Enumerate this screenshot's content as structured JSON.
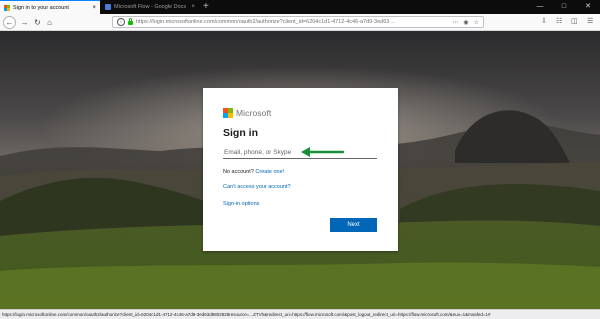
{
  "tabs": [
    {
      "label": "Sign in to your account",
      "close": "×"
    },
    {
      "label": "Microsoft Flow - Google Docs",
      "close": "×"
    }
  ],
  "toolbar": {
    "new_tab": "+",
    "url": "https://login.microsoftonline.com/common/oauth2/authorize?client_id=6204c1d1-4712-4c46-a7d9-3ed63",
    "url_host": "login.microsoftonline.com",
    "url_ellipsis": "..."
  },
  "card": {
    "brand": "Microsoft",
    "title": "Sign in",
    "email_placeholder": "Email, phone, or Skype",
    "no_account_text": "No account?",
    "create_link": "Create one!",
    "cant_access_link": "Can’t access your account?",
    "signin_options_link": "Sign-in options",
    "next_button": "Next"
  },
  "status": {
    "text": "https://login.microsoftonline.com/common/oauth2/authorize?client_id=6204c1d1-4712-4c46-a7d9-3ed63d9802828resource=...ZTVh&redirect_uri=https://flow.microsoft.com/&post_logout_redirect_uri=https://flow.microsoft.com/&nux=1&msafed=1#"
  },
  "colors": {
    "ms_red": "#f25022",
    "ms_green": "#7fba00",
    "ms_blue": "#00a4ef",
    "ms_yellow": "#ffb900",
    "link_blue": "#0067b8",
    "arrow_green": "#1a8f3a"
  }
}
